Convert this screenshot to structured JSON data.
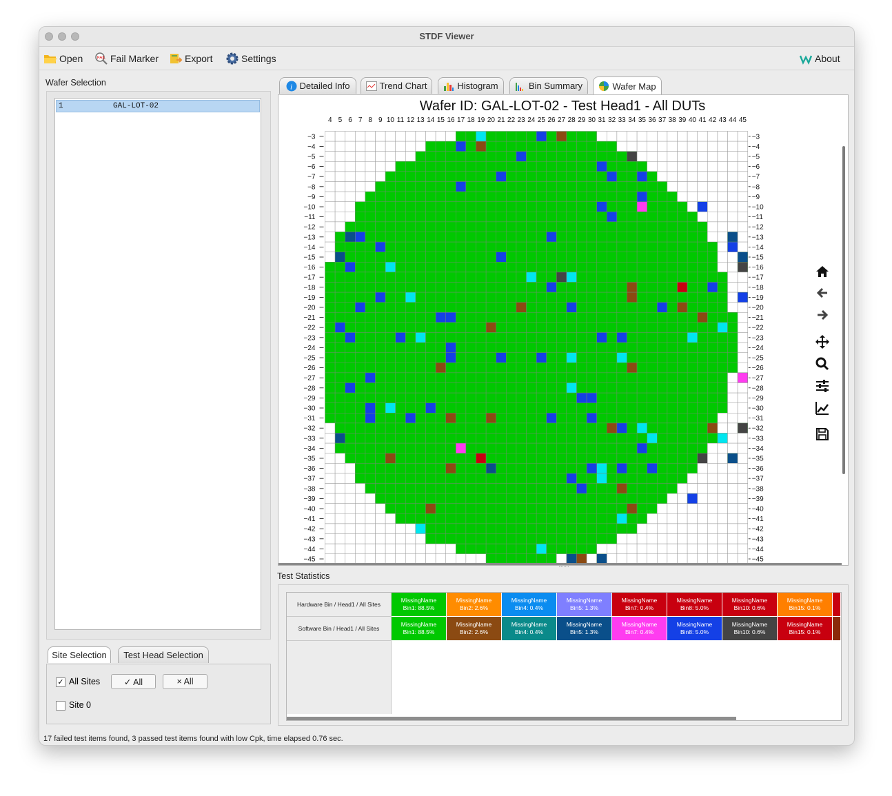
{
  "window": {
    "title": "STDF Viewer"
  },
  "toolbar": {
    "open": "Open",
    "fail_marker": "Fail Marker",
    "export": "Export",
    "settings": "Settings",
    "about": "About"
  },
  "wafer_selection": {
    "label": "Wafer Selection",
    "rows": [
      {
        "index": "1",
        "name": "GAL-LOT-02"
      }
    ]
  },
  "bottom_tabs": {
    "site": "Site Selection",
    "head": "Test Head Selection"
  },
  "site_panel": {
    "all_sites": "All Sites",
    "select_all": "✓ All",
    "deselect_all": "× All",
    "site0": "Site 0"
  },
  "main_tabs": {
    "detailed": "Detailed Info",
    "trend": "Trend Chart",
    "histogram": "Histogram",
    "bin": "Bin Summary",
    "wafer": "Wafer Map"
  },
  "chart_data": {
    "type": "heatmap",
    "title": "Wafer ID: GAL-LOT-02 - Test Head1 - All DUTs",
    "x_range": [
      4,
      45
    ],
    "y_range": [
      -3,
      -45
    ],
    "grid": true,
    "background_bin_color": "#00c800",
    "notable_dies": [
      {
        "x": 19,
        "y": -3,
        "bin": "Bin4"
      },
      {
        "x": 25,
        "y": -3,
        "bin": "Bin8"
      },
      {
        "x": 27,
        "y": -3,
        "bin": "Bin2"
      },
      {
        "x": 17,
        "y": -4,
        "bin": "Bin8"
      },
      {
        "x": 19,
        "y": -4,
        "bin": "Bin2"
      },
      {
        "x": 23,
        "y": -5,
        "bin": "Bin8"
      },
      {
        "x": 34,
        "y": -5,
        "bin": "Bin10"
      },
      {
        "x": 31,
        "y": -6,
        "bin": "Bin8"
      },
      {
        "x": 21,
        "y": -7,
        "bin": "Bin8"
      },
      {
        "x": 32,
        "y": -7,
        "bin": "Bin8"
      },
      {
        "x": 35,
        "y": -7,
        "bin": "Bin8"
      },
      {
        "x": 17,
        "y": -8,
        "bin": "Bin8"
      },
      {
        "x": 35,
        "y": -9,
        "bin": "Bin8"
      },
      {
        "x": 31,
        "y": -10,
        "bin": "Bin8"
      },
      {
        "x": 35,
        "y": -10,
        "bin": "Bin7"
      },
      {
        "x": 41,
        "y": -10,
        "bin": "Bin8"
      },
      {
        "x": 32,
        "y": -11,
        "bin": "Bin8"
      },
      {
        "x": 6,
        "y": -13,
        "bin": "Bin5"
      },
      {
        "x": 7,
        "y": -13,
        "bin": "Bin8"
      },
      {
        "x": 26,
        "y": -13,
        "bin": "Bin8"
      },
      {
        "x": 44,
        "y": -13,
        "bin": "Bin5"
      },
      {
        "x": 9,
        "y": -14,
        "bin": "Bin8"
      },
      {
        "x": 44,
        "y": -14,
        "bin": "Bin8"
      },
      {
        "x": 5,
        "y": -15,
        "bin": "Bin5"
      },
      {
        "x": 21,
        "y": -15,
        "bin": "Bin8"
      },
      {
        "x": 45,
        "y": -15,
        "bin": "Bin5"
      },
      {
        "x": 6,
        "y": -16,
        "bin": "Bin8"
      },
      {
        "x": 10,
        "y": -16,
        "bin": "Bin4"
      },
      {
        "x": 45,
        "y": -16,
        "bin": "Bin10"
      },
      {
        "x": 24,
        "y": -17,
        "bin": "Bin4"
      },
      {
        "x": 27,
        "y": -17,
        "bin": "Bin10"
      },
      {
        "x": 28,
        "y": -17,
        "bin": "Bin4"
      },
      {
        "x": 26,
        "y": -18,
        "bin": "Bin8"
      },
      {
        "x": 34,
        "y": -18,
        "bin": "Bin2"
      },
      {
        "x": 39,
        "y": -18,
        "bin": "Bin15"
      },
      {
        "x": 42,
        "y": -18,
        "bin": "Bin8"
      },
      {
        "x": 9,
        "y": -19,
        "bin": "Bin8"
      },
      {
        "x": 12,
        "y": -19,
        "bin": "Bin4"
      },
      {
        "x": 34,
        "y": -19,
        "bin": "Bin2"
      },
      {
        "x": 45,
        "y": -19,
        "bin": "Bin8"
      },
      {
        "x": 7,
        "y": -20,
        "bin": "Bin8"
      },
      {
        "x": 23,
        "y": -20,
        "bin": "Bin2"
      },
      {
        "x": 28,
        "y": -20,
        "bin": "Bin8"
      },
      {
        "x": 37,
        "y": -20,
        "bin": "Bin8"
      },
      {
        "x": 39,
        "y": -20,
        "bin": "Bin2"
      },
      {
        "x": 15,
        "y": -21,
        "bin": "Bin8"
      },
      {
        "x": 16,
        "y": -21,
        "bin": "Bin8"
      },
      {
        "x": 41,
        "y": -21,
        "bin": "Bin2"
      },
      {
        "x": 5,
        "y": -22,
        "bin": "Bin8"
      },
      {
        "x": 20,
        "y": -22,
        "bin": "Bin2"
      },
      {
        "x": 43,
        "y": -22,
        "bin": "Bin4"
      },
      {
        "x": 6,
        "y": -23,
        "bin": "Bin8"
      },
      {
        "x": 11,
        "y": -23,
        "bin": "Bin8"
      },
      {
        "x": 13,
        "y": -23,
        "bin": "Bin4"
      },
      {
        "x": 31,
        "y": -23,
        "bin": "Bin8"
      },
      {
        "x": 33,
        "y": -23,
        "bin": "Bin8"
      },
      {
        "x": 40,
        "y": -23,
        "bin": "Bin4"
      },
      {
        "x": 16,
        "y": -24,
        "bin": "Bin8"
      },
      {
        "x": 16,
        "y": -25,
        "bin": "Bin8"
      },
      {
        "x": 21,
        "y": -25,
        "bin": "Bin8"
      },
      {
        "x": 25,
        "y": -25,
        "bin": "Bin8"
      },
      {
        "x": 28,
        "y": -25,
        "bin": "Bin4"
      },
      {
        "x": 33,
        "y": -25,
        "bin": "Bin4"
      },
      {
        "x": 15,
        "y": -26,
        "bin": "Bin2"
      },
      {
        "x": 34,
        "y": -26,
        "bin": "Bin2"
      },
      {
        "x": 8,
        "y": -27,
        "bin": "Bin8"
      },
      {
        "x": 45,
        "y": -27,
        "bin": "Bin7"
      },
      {
        "x": 6,
        "y": -28,
        "bin": "Bin8"
      },
      {
        "x": 28,
        "y": -28,
        "bin": "Bin4"
      },
      {
        "x": 29,
        "y": -29,
        "bin": "Bin8"
      },
      {
        "x": 30,
        "y": -29,
        "bin": "Bin8"
      },
      {
        "x": 8,
        "y": -30,
        "bin": "Bin8"
      },
      {
        "x": 10,
        "y": -30,
        "bin": "Bin4"
      },
      {
        "x": 14,
        "y": -30,
        "bin": "Bin8"
      },
      {
        "x": 8,
        "y": -31,
        "bin": "Bin8"
      },
      {
        "x": 12,
        "y": -31,
        "bin": "Bin8"
      },
      {
        "x": 16,
        "y": -31,
        "bin": "Bin2"
      },
      {
        "x": 20,
        "y": -31,
        "bin": "Bin2"
      },
      {
        "x": 26,
        "y": -31,
        "bin": "Bin8"
      },
      {
        "x": 30,
        "y": -31,
        "bin": "Bin8"
      },
      {
        "x": 32,
        "y": -32,
        "bin": "Bin2"
      },
      {
        "x": 33,
        "y": -32,
        "bin": "Bin8"
      },
      {
        "x": 35,
        "y": -32,
        "bin": "Bin4"
      },
      {
        "x": 42,
        "y": -32,
        "bin": "Bin2"
      },
      {
        "x": 45,
        "y": -32,
        "bin": "Bin10"
      },
      {
        "x": 5,
        "y": -33,
        "bin": "Bin5"
      },
      {
        "x": 36,
        "y": -33,
        "bin": "Bin4"
      },
      {
        "x": 43,
        "y": -33,
        "bin": "Bin4"
      },
      {
        "x": 17,
        "y": -34,
        "bin": "Bin7"
      },
      {
        "x": 35,
        "y": -34,
        "bin": "Bin8"
      },
      {
        "x": 10,
        "y": -35,
        "bin": "Bin2"
      },
      {
        "x": 19,
        "y": -35,
        "bin": "Bin15"
      },
      {
        "x": 41,
        "y": -35,
        "bin": "Bin10"
      },
      {
        "x": 44,
        "y": -35,
        "bin": "Bin5"
      },
      {
        "x": 16,
        "y": -36,
        "bin": "Bin2"
      },
      {
        "x": 20,
        "y": -36,
        "bin": "Bin5"
      },
      {
        "x": 30,
        "y": -36,
        "bin": "Bin8"
      },
      {
        "x": 31,
        "y": -36,
        "bin": "Bin4"
      },
      {
        "x": 33,
        "y": -36,
        "bin": "Bin8"
      },
      {
        "x": 36,
        "y": -36,
        "bin": "Bin8"
      },
      {
        "x": 28,
        "y": -37,
        "bin": "Bin8"
      },
      {
        "x": 31,
        "y": -37,
        "bin": "Bin4"
      },
      {
        "x": 29,
        "y": -38,
        "bin": "Bin8"
      },
      {
        "x": 33,
        "y": -38,
        "bin": "Bin2"
      },
      {
        "x": 40,
        "y": -39,
        "bin": "Bin8"
      },
      {
        "x": 14,
        "y": -40,
        "bin": "Bin2"
      },
      {
        "x": 34,
        "y": -40,
        "bin": "Bin2"
      },
      {
        "x": 33,
        "y": -41,
        "bin": "Bin4"
      },
      {
        "x": 13,
        "y": -42,
        "bin": "Bin4"
      },
      {
        "x": 25,
        "y": -44,
        "bin": "Bin4"
      },
      {
        "x": 28,
        "y": -45,
        "bin": "Bin5"
      },
      {
        "x": 29,
        "y": -45,
        "bin": "Bin2"
      },
      {
        "x": 31,
        "y": -45,
        "bin": "Bin5"
      }
    ],
    "bin_colors": {
      "Bin1": "#00c800",
      "Bin2": "#8b4a12",
      "Bin4": "#00e6f0",
      "Bin5": "#0a4f8a",
      "Bin7": "#ff3cf0",
      "Bin8": "#1440e6",
      "Bin10": "#444444",
      "Bin15": "#c8000f"
    }
  },
  "stats": {
    "label": "Test Statistics",
    "hw_header": "Hardware Bin / Head1 / All Sites",
    "sw_header": "Software Bin / Head1 / All Sites",
    "hw": [
      {
        "name": "MissingName",
        "val": "Bin1: 88.5%",
        "color": "#00c800"
      },
      {
        "name": "MissingName",
        "val": "Bin2: 2.6%",
        "color": "#ff8c00"
      },
      {
        "name": "MissingName",
        "val": "Bin4: 0.4%",
        "color": "#0a8cf0"
      },
      {
        "name": "MissingName",
        "val": "Bin5: 1.3%",
        "color": "#7f7fff"
      },
      {
        "name": "MissingName",
        "val": "Bin7: 0.4%",
        "color": "#c8000f"
      },
      {
        "name": "MissingName",
        "val": "Bin8: 5.0%",
        "color": "#c8000f"
      },
      {
        "name": "MissingName",
        "val": "Bin10: 0.6%",
        "color": "#c8000f"
      },
      {
        "name": "MissingName",
        "val": "Bin15: 0.1%",
        "color": "#ff7f00"
      }
    ],
    "sw": [
      {
        "name": "MissingName",
        "val": "Bin1: 88.5%",
        "color": "#00c800"
      },
      {
        "name": "MissingName",
        "val": "Bin2: 2.6%",
        "color": "#8b4a12"
      },
      {
        "name": "MissingName",
        "val": "Bin4: 0.4%",
        "color": "#0a8a8a"
      },
      {
        "name": "MissingName",
        "val": "Bin5: 1.3%",
        "color": "#0a4f8a"
      },
      {
        "name": "MissingName",
        "val": "Bin7: 0.4%",
        "color": "#ff3cf0"
      },
      {
        "name": "MissingName",
        "val": "Bin8: 5.0%",
        "color": "#1440e6"
      },
      {
        "name": "MissingName",
        "val": "Bin10: 0.6%",
        "color": "#444444"
      },
      {
        "name": "MissingName",
        "val": "Bin15: 0.1%",
        "color": "#c8000f"
      }
    ]
  },
  "status_text": "17 failed test items found, 3 passed test items found with low Cpk, time elapsed 0.76 sec."
}
